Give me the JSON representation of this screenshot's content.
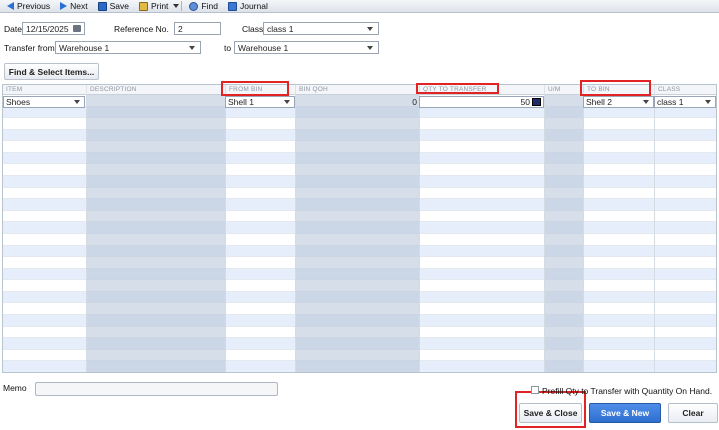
{
  "toolbar": {
    "previous": "Previous",
    "next": "Next",
    "save": "Save",
    "print": "Print",
    "find": "Find",
    "journal": "Journal"
  },
  "form": {
    "date_label": "Date",
    "date_value": "12/15/2025",
    "reference_label": "Reference No.",
    "reference_value": "2",
    "class_label": "Class",
    "class_value": "class 1",
    "transfer_from_label": "Transfer from",
    "transfer_from_value": "Warehouse 1",
    "to_label": "to",
    "to_value": "Warehouse 1",
    "find_select_button": "Find & Select Items..."
  },
  "grid": {
    "columns": {
      "item": "ITEM",
      "description": "DESCRIPTION",
      "from_bin": "FROM BIN",
      "bin_qoh": "BIN QOH",
      "qty_to_transfer": "QTY TO TRANSFER",
      "um": "U/M",
      "to_bin": "TO BIN",
      "class": "CLASS"
    },
    "row1": {
      "item": "Shoes",
      "description": "",
      "from_bin": "Shell 1",
      "bin_qoh": "0",
      "qty_to_transfer": "50",
      "um": "",
      "to_bin": "Shell 2",
      "class": "class 1"
    },
    "row_count": 24
  },
  "footer": {
    "memo_label": "Memo",
    "memo_value": "",
    "prefill_label": "Prefill Qty to Transfer with Quantity On Hand.",
    "save_close": "Save & Close",
    "save_new": "Save & New",
    "clear": "Clear"
  },
  "colors": {
    "highlight": "#e12323",
    "primary_button": "#2f6fd1",
    "row_alt": "#e6eefb"
  }
}
